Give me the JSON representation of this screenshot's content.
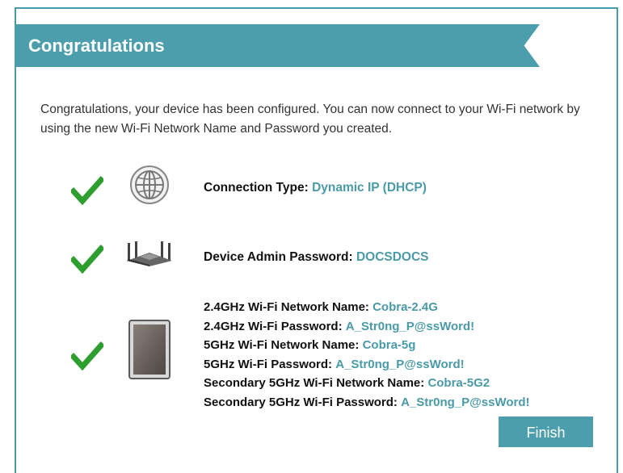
{
  "banner": {
    "title": "Congratulations"
  },
  "intro_text": "Congratulations, your device has been configured. You can now connect to your Wi-Fi network by using the new Wi-Fi Network Name and Password you created.",
  "connection": {
    "label": "Connection Type:",
    "value": "Dynamic IP (DHCP)",
    "icon": "globe-icon"
  },
  "admin": {
    "label": "Device Admin Password:",
    "value": "DOCSDOCS",
    "icon": "router-icon"
  },
  "wifi": {
    "icon": "tablet-icon",
    "lines": [
      {
        "label": "2.4GHz Wi-Fi Network Name:",
        "value": "Cobra-2.4G"
      },
      {
        "label": "2.4GHz Wi-Fi Password:",
        "value": "A_Str0ng_P@ssWord!"
      },
      {
        "label": "5GHz Wi-Fi Network Name:",
        "value": "Cobra-5g"
      },
      {
        "label": "5GHz Wi-Fi Password:",
        "value": "A_Str0ng_P@ssWord!"
      },
      {
        "label": "Secondary 5GHz Wi-Fi Network Name:",
        "value": "Cobra-5G2"
      },
      {
        "label": "Secondary 5GHz Wi-Fi Password:",
        "value": "A_Str0ng_P@ssWord!"
      }
    ]
  },
  "finish_button": {
    "label": "Finish"
  },
  "colors": {
    "accent": "#4d9eac",
    "check": "#2e9e2e",
    "value_text": "#4a9aa8"
  }
}
